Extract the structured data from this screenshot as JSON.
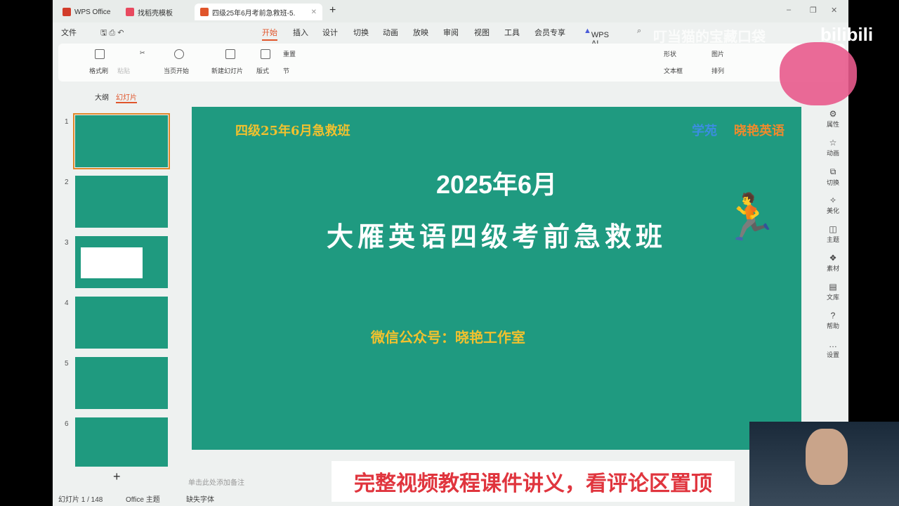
{
  "tabs": [
    {
      "label": "WPS Office",
      "color": "#d23c2a"
    },
    {
      "label": "找稻壳模板",
      "color": "#e84a5f"
    },
    {
      "label": "四级25年6月考前急救班-5.",
      "color": "#e0552b"
    }
  ],
  "menu": {
    "file": "文件",
    "items": [
      "开始",
      "插入",
      "设计",
      "切换",
      "动画",
      "放映",
      "审阅",
      "视图",
      "工具",
      "会员专享"
    ],
    "ai": "WPS AI"
  },
  "ribbon": {
    "format_painter": "格式刷",
    "paste": "粘贴",
    "from_current": "当页开始",
    "new_slide": "新建幻灯片",
    "layout": "版式",
    "section": "节",
    "reset": "重置",
    "shape": "形状",
    "picture": "图片",
    "textbox": "文本框",
    "arrange": "排列"
  },
  "panel": {
    "outline": "大纲",
    "slides": "幻灯片",
    "add": "+"
  },
  "thumbnails": [
    "1",
    "2",
    "3",
    "4",
    "5",
    "6"
  ],
  "slide": {
    "header": "四级25年6月急救班",
    "logo": "晓艳英语",
    "logo_mark": "学苑",
    "date": "2025年6月",
    "title": "大雁英语四级考前急救班",
    "wechat": "微信公众号：晓艳工作室"
  },
  "notes_placeholder": "单击此处添加备注",
  "right_sidebar": [
    "属性",
    "动画",
    "切换",
    "美化",
    "主题",
    "素材",
    "文库",
    "帮助",
    "设置"
  ],
  "status": {
    "slide_count": "幻灯片 1 / 148",
    "theme": "Office 主题",
    "missing_font": "缺失字体"
  },
  "overlay": {
    "banner": "完整视频教程课件讲义，看评论区置顶",
    "watermark": "叮当猫的宝藏口袋",
    "bili": "bilibili"
  },
  "colors": {
    "accent": "#e0552b",
    "slide_bg": "#1f9a80",
    "gold": "#f2c12e"
  }
}
